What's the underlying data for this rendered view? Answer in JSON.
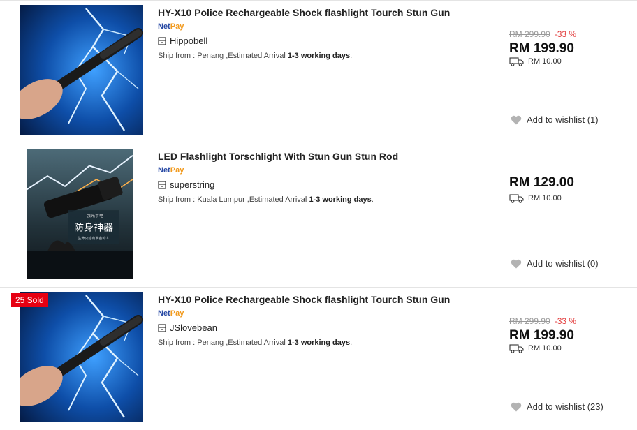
{
  "products": [
    {
      "title": "HY-X10 Police Rechargeable Shock flashlight Tourch Stun Gun",
      "netpay": {
        "net": "Net",
        "pay": "Pay"
      },
      "shop": "Hippobell",
      "ship_prefix": "Ship from : Penang ,Estimated Arrival ",
      "ship_days": "1-3 working days",
      "ship_suffix": ".",
      "old_price": "RM 299.90",
      "discount": "-33 %",
      "price": "RM 199.90",
      "shipping_fee": "RM 10.00",
      "wishlist": "Add to wishlist (1)",
      "sold_badge": ""
    },
    {
      "title": "LED Flashlight Torschlight With Stun Gun Stun Rod",
      "netpay": {
        "net": "Net",
        "pay": "Pay"
      },
      "shop": "superstring",
      "ship_prefix": "Ship from : Kuala Lumpur ,Estimated Arrival ",
      "ship_days": "1-3 working days",
      "ship_suffix": ".",
      "price": "RM 129.00",
      "shipping_fee": "RM 10.00",
      "wishlist": "Add to wishlist (0)",
      "image_text": {
        "top": "强光手电",
        "big": "防身神器",
        "sub": "生命只给有准备的人"
      }
    },
    {
      "title": "HY-X10 Police Rechargeable Shock flashlight Tourch Stun Gun",
      "netpay": {
        "net": "Net",
        "pay": "Pay"
      },
      "shop": "JSlovebean",
      "ship_prefix": "Ship from : Penang ,Estimated Arrival ",
      "ship_days": "1-3 working days",
      "ship_suffix": ".",
      "old_price": "RM 299.90",
      "discount": "-33 %",
      "price": "RM 199.90",
      "shipping_fee": "RM 10.00",
      "wishlist": "Add to wishlist (23)",
      "sold_badge": "25 Sold"
    }
  ],
  "colors": {
    "netpay_net": "#2a4ba5",
    "netpay_pay": "#f19a1e",
    "discount": "#e23a3a",
    "sold_badge": "#e60012",
    "wishlist_heart": "#b3b3b3"
  },
  "icons": {
    "shop": "shop-icon",
    "shipping": "truck-icon",
    "wishlist": "heart-icon"
  }
}
